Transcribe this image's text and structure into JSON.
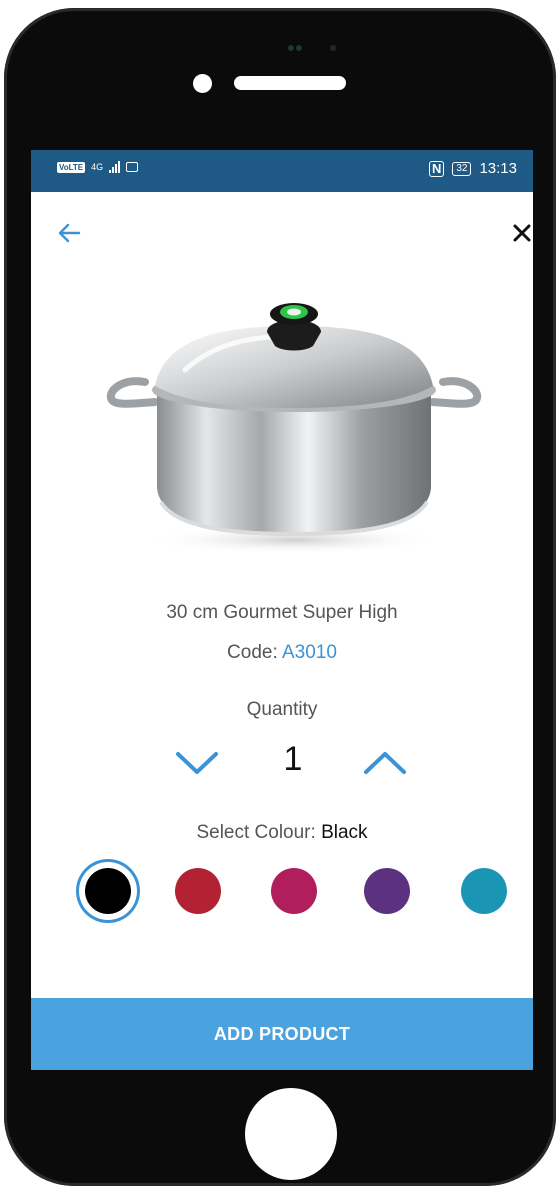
{
  "status_bar": {
    "volte": "VoLTE",
    "network": "4G",
    "nfc": "N",
    "battery": "32",
    "time": "13:13",
    "color": "#1f5a87"
  },
  "nav": {
    "back_icon": "arrow-left-icon",
    "close_icon": "close-icon",
    "accent": "#3a93d6"
  },
  "product": {
    "name": "30 cm Gourmet Super High",
    "code_label": "Code: ",
    "code_value": "A3010",
    "image": "stainless-steel-pot-with-lid"
  },
  "quantity": {
    "label": "Quantity",
    "value": "1",
    "decrease_icon": "chevron-down-icon",
    "increase_icon": "chevron-up-icon"
  },
  "colour": {
    "label": "Select Colour: ",
    "selected": "Black",
    "options": [
      {
        "name": "Black",
        "color": "#000000"
      },
      {
        "name": "Red",
        "color": "#b32232"
      },
      {
        "name": "Raspberry",
        "color": "#b01e5c"
      },
      {
        "name": "Purple",
        "color": "#5c3280"
      },
      {
        "name": "Teal",
        "color": "#1a96b4"
      }
    ]
  },
  "actions": {
    "add_product": "ADD PRODUCT",
    "button_color": "#4aa3df"
  }
}
